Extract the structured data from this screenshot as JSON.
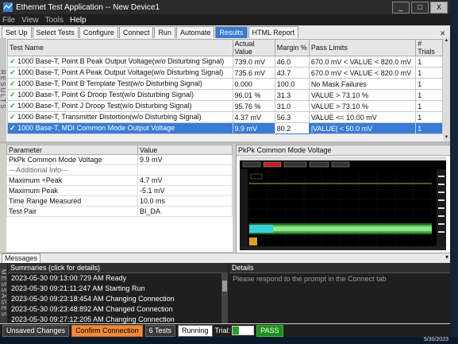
{
  "window": {
    "title": "Ethernet Test Application -- New Device1",
    "controls": [
      "_",
      "□",
      "X"
    ]
  },
  "menu": [
    "File",
    "View",
    "Tools",
    "Help"
  ],
  "tabs": [
    "Set Up",
    "Select Tests",
    "Configure",
    "Connect",
    "Run",
    "Automate",
    "Results",
    "HTML Report"
  ],
  "active_tab": "Results",
  "results": {
    "side_label": "RESULTS",
    "columns": [
      "Test Name",
      "Actual Value",
      "Margin %",
      "Pass Limits",
      "# Trials"
    ],
    "rows": [
      {
        "name": "1000 Base-T, Point B Peak Output Voltage(w/o Disturbing Signal)",
        "actual": "739.0 mV",
        "margin": "46.0",
        "limits": "670.0 mV < VALUE < 820.0 mV",
        "trials": "1"
      },
      {
        "name": "1000 Base-T, Point A Peak Output Voltage(w/o Disturbing Signal)",
        "actual": "735.6 mV",
        "margin": "43.7",
        "limits": "670.0 mV < VALUE < 820.0 mV",
        "trials": "1"
      },
      {
        "name": "1000 Base-T, Point B Template Test(w/o Disturbing Signal)",
        "actual": "0.000",
        "margin": "100.0",
        "limits": "No Mask Failures",
        "trials": "1"
      },
      {
        "name": "1000 Base-T, Point G Droop Test(w/o Disturbing Signal)",
        "actual": "96.01 %",
        "margin": "31.3",
        "limits": "VALUE > 73.10 %",
        "trials": "1"
      },
      {
        "name": "1000 Base-T, Point J Droop Test(w/o Disturbing Signal)",
        "actual": "95.76 %",
        "margin": "31.0",
        "limits": "VALUE > 73.10 %",
        "trials": "1"
      },
      {
        "name": "1000 Base-T, Transmitter Distortion(w/o Disturbing Signal)",
        "actual": "4.37 mV",
        "margin": "56.3",
        "limits": "VALUE <= 10.00 mV",
        "trials": "1"
      },
      {
        "name": "1000 Base-T, MDI Common Mode Output Voltage",
        "actual": "9.9 mV",
        "margin": "80.2",
        "limits": "|VALUE| < 50.0 mV",
        "trials": "1"
      }
    ]
  },
  "params": {
    "columns": [
      "Parameter",
      "Value"
    ],
    "rows": [
      {
        "p": "PkPk Common Mode Voltage",
        "v": "9.9 mV"
      },
      {
        "p": "---Additional Info---",
        "v": ""
      },
      {
        "p": "Maximum +Peak",
        "v": "4.7 mV"
      },
      {
        "p": "Maximum Peak",
        "v": "-5.1 mV"
      },
      {
        "p": "Time Range Measured",
        "v": "10.0 ms"
      },
      {
        "p": "Test Pair",
        "v": "BI_DA"
      }
    ]
  },
  "chart": {
    "title": "PkPk Common Mode Voltage"
  },
  "messages": {
    "tab": "Messages",
    "side_label": "MESSAGES",
    "summaries_header": "Summaries (click for details)",
    "details_header": "Details",
    "details_text": "Please respond to the prompt in the Connect tab",
    "items": [
      "2023-05-30 09:13:00:729 AM Ready",
      "2023-05-30 09:21:11:247 AM Starting Run",
      "2023-05-30 09:23:18:454 AM Changing Connection",
      "2023-05-30 09:23:48:892 AM Changed Connection",
      "2023-05-30 09:27:12:205 AM Changing Connection"
    ]
  },
  "status": {
    "unsaved": "Unsaved Changes",
    "confirm": "Confirm Connection",
    "tests": "6 Tests",
    "running": "Running",
    "trial": "Trial:",
    "pass": "PASS"
  },
  "clock": "5/30/2023"
}
